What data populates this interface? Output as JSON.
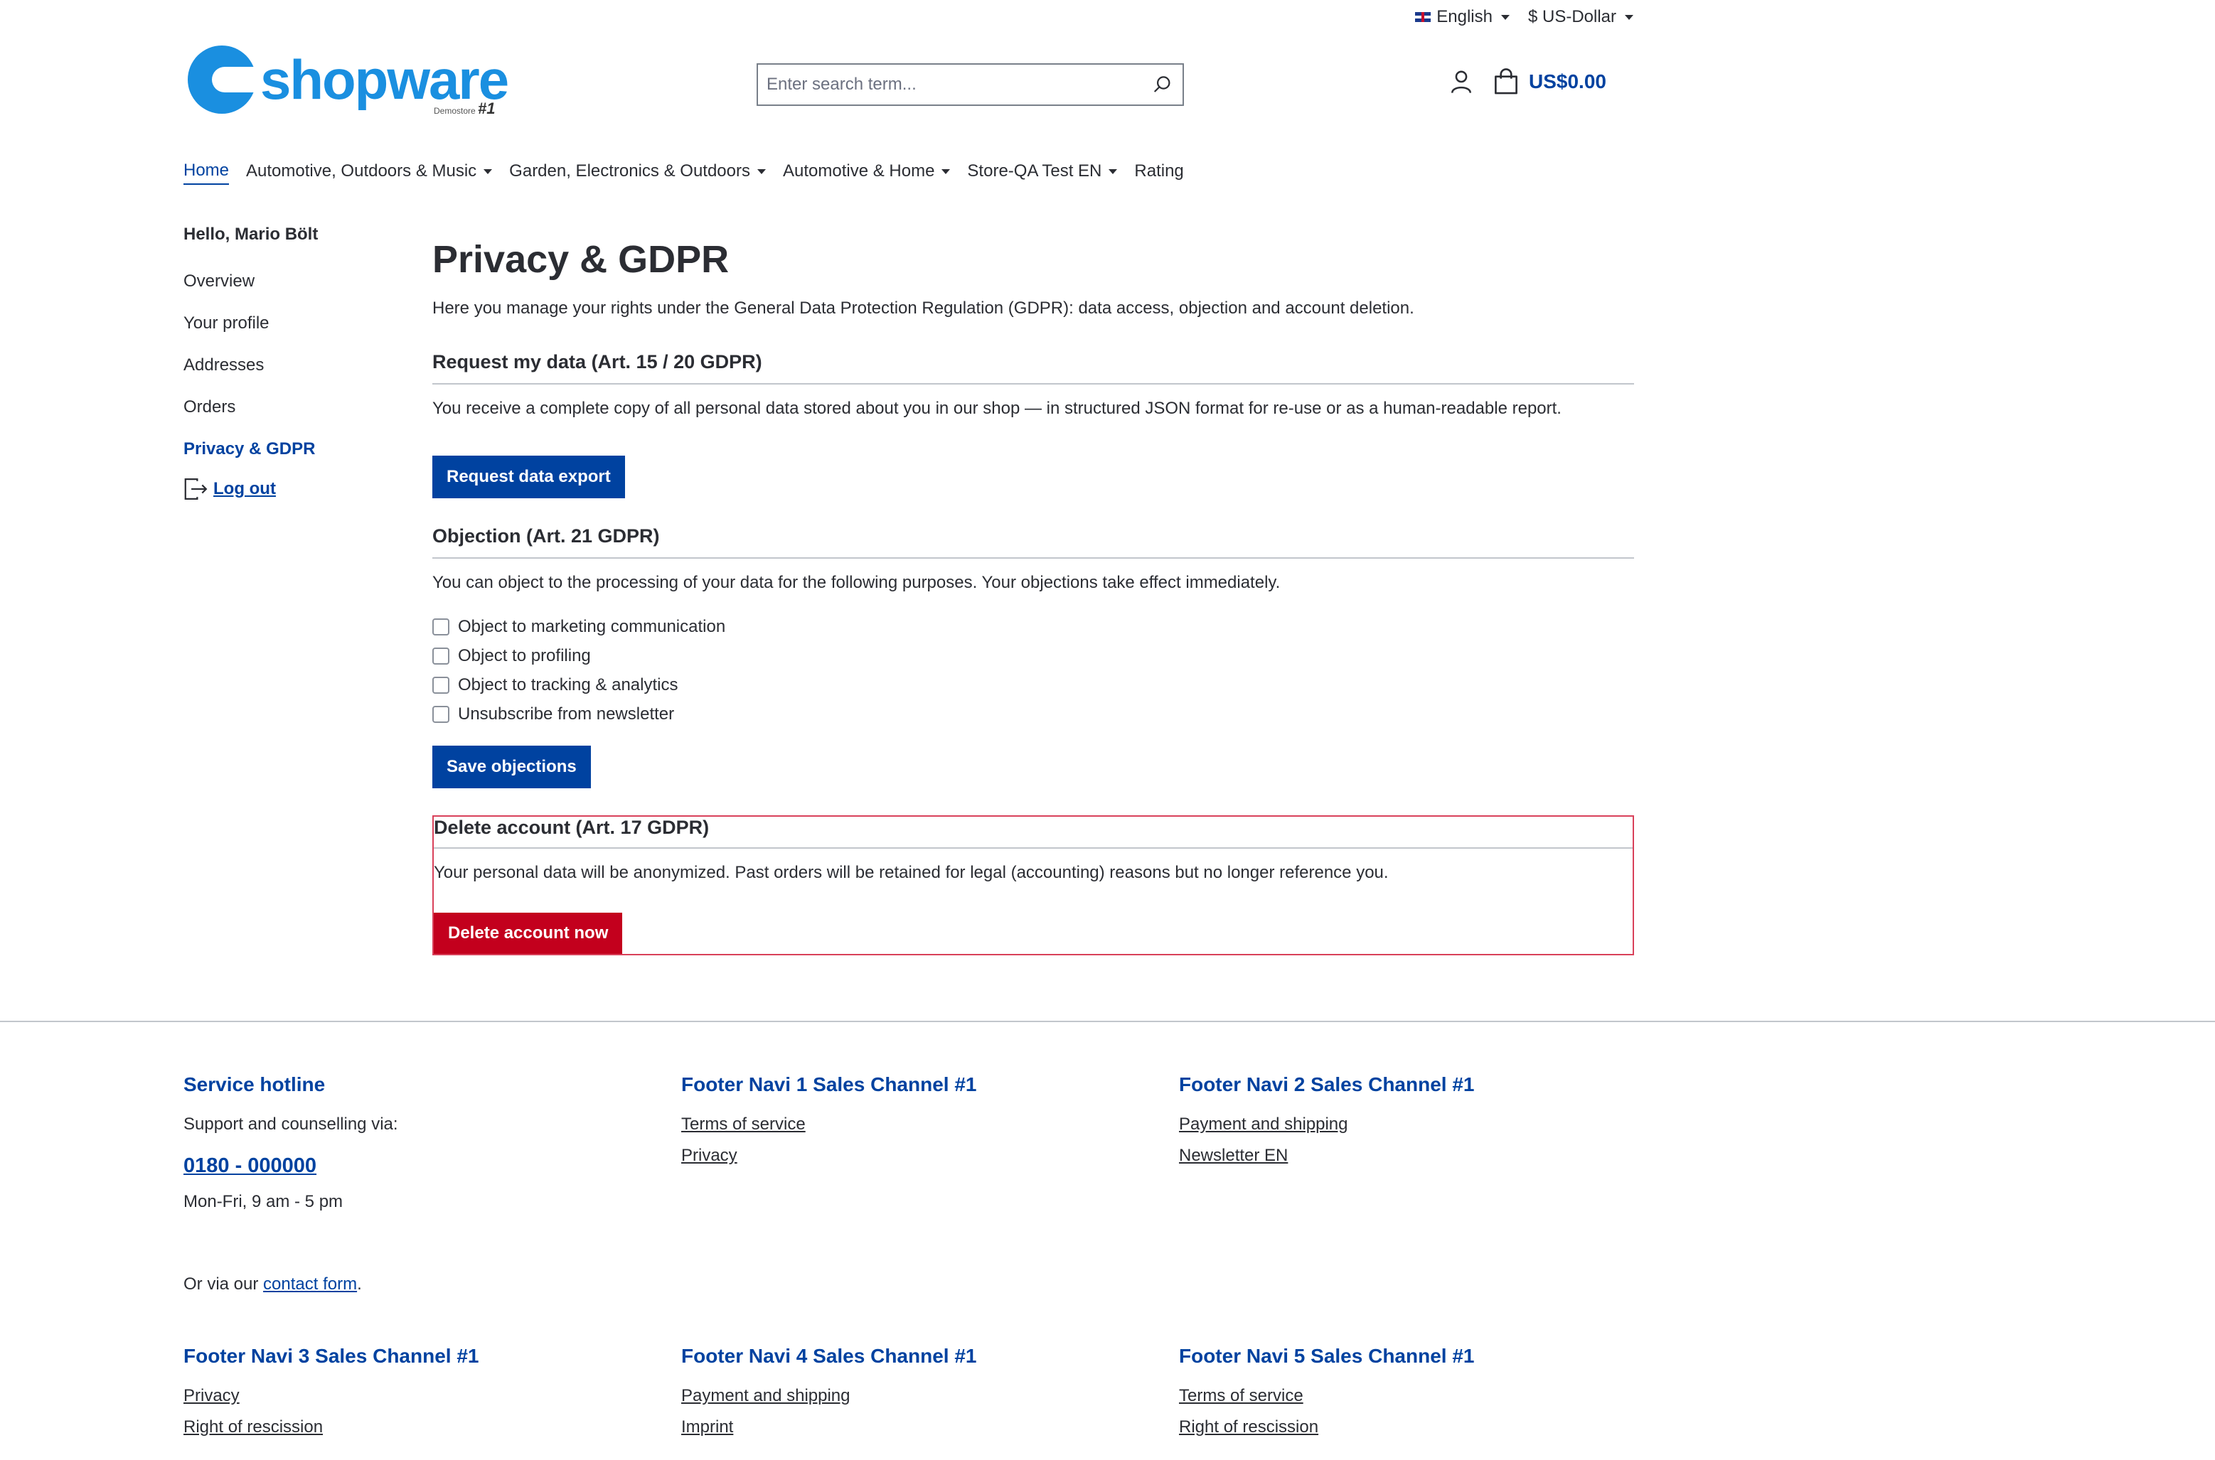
{
  "topbar": {
    "language": "English",
    "currency": "$ US-Dollar"
  },
  "header": {
    "logo_text": "shopware",
    "logo_sub": "Demostore",
    "logo_sub_mark": "#1",
    "search_placeholder": "Enter search term...",
    "cart_total": "US$0.00"
  },
  "nav": {
    "items": [
      {
        "label": "Home"
      },
      {
        "label": "Automotive, Outdoors & Music"
      },
      {
        "label": "Garden, Electronics & Outdoors"
      },
      {
        "label": "Automotive & Home"
      },
      {
        "label": "Store-QA Test EN"
      },
      {
        "label": "Rating"
      }
    ]
  },
  "sidebar": {
    "greeting": "Hello, Mario Bölt",
    "links": [
      {
        "label": "Overview"
      },
      {
        "label": "Your profile"
      },
      {
        "label": "Addresses"
      },
      {
        "label": "Orders"
      },
      {
        "label": "Privacy & GDPR"
      }
    ],
    "logout": "Log out"
  },
  "main": {
    "title": "Privacy & GDPR",
    "intro": "Here you manage your rights under the General Data Protection Regulation (GDPR): data access, objection and account deletion.",
    "request": {
      "heading": "Request my data (Art. 15 / 20 GDPR)",
      "text": "You receive a complete copy of all personal data stored about you in our shop — in structured JSON format for re-use or as a human-readable report.",
      "button": "Request data export"
    },
    "objection": {
      "heading": "Objection (Art. 21 GDPR)",
      "text": "You can object to the processing of your data for the following purposes. Your objections take effect immediately.",
      "options": [
        {
          "label": "Object to marketing communication"
        },
        {
          "label": "Object to profiling"
        },
        {
          "label": "Object to tracking & analytics"
        },
        {
          "label": "Unsubscribe from newsletter"
        }
      ],
      "button": "Save objections"
    },
    "delete": {
      "heading": "Delete account (Art. 17 GDPR)",
      "text": "Your personal data will be anonymized. Past orders will be retained for legal (accounting) reasons but no longer reference you.",
      "button": "Delete account now"
    }
  },
  "footer": {
    "hotline": {
      "heading": "Service hotline",
      "text": "Support and counselling via:",
      "phone": "0180 - 000000",
      "hours": "Mon-Fri, 9 am - 5 pm",
      "contact_prefix": "Or via our",
      "contact_link": "contact form",
      "contact_suffix": "."
    },
    "nav1": {
      "heading": "Footer Navi 1 Sales Channel #1",
      "links": [
        "Terms of service",
        "Privacy"
      ]
    },
    "nav2": {
      "heading": "Footer Navi 2 Sales Channel #1",
      "links": [
        "Payment and shipping",
        "Newsletter EN"
      ]
    },
    "nav3": {
      "heading": "Footer Navi 3 Sales Channel #1",
      "links": [
        "Privacy",
        "Right of rescission"
      ]
    },
    "nav4": {
      "heading": "Footer Navi 4 Sales Channel #1",
      "links": [
        "Payment and shipping",
        "Imprint"
      ]
    },
    "nav5": {
      "heading": "Footer Navi 5 Sales Channel #1",
      "links": [
        "Terms of service",
        "Right of rescission"
      ]
    }
  },
  "colors": {
    "primary": "#0042a0",
    "danger": "#c3001d",
    "brand": "#1a8fe0"
  }
}
